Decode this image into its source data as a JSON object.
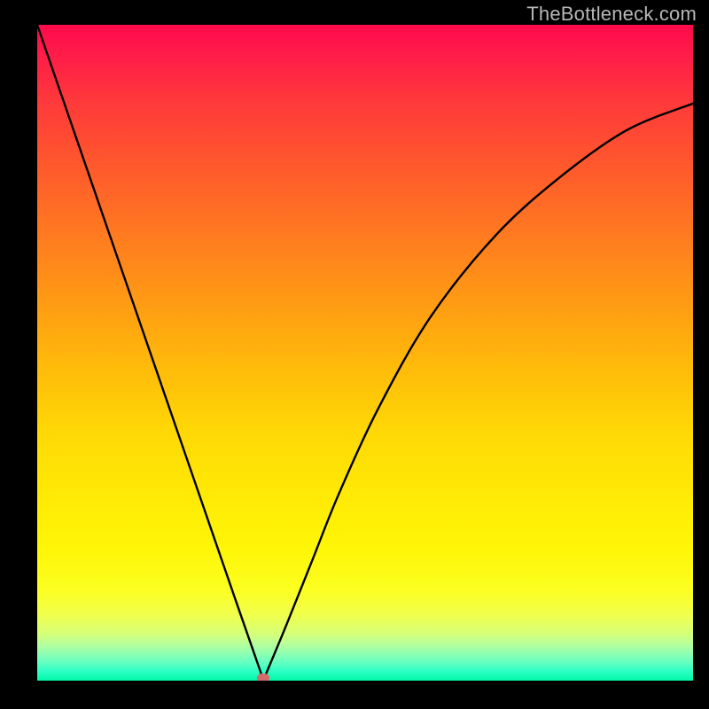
{
  "watermark": "TheBottleneck.com",
  "colors": {
    "background": "#000000",
    "curve": "#000000",
    "marker": "#d46a6a",
    "watermark": "#b7b7b7"
  },
  "chart_data": {
    "type": "line",
    "title": "",
    "xlabel": "",
    "ylabel": "",
    "xlim": [
      0,
      1
    ],
    "ylim": [
      0,
      1
    ],
    "grid": false,
    "legend": false,
    "annotations": [],
    "series": [
      {
        "name": "bottleneck-curve",
        "x": [
          0.0,
          0.05,
          0.1,
          0.15,
          0.2,
          0.25,
          0.3,
          0.34,
          0.345,
          0.35,
          0.38,
          0.42,
          0.46,
          0.52,
          0.6,
          0.7,
          0.8,
          0.9,
          1.0
        ],
        "y": [
          1.0,
          0.855,
          0.71,
          0.565,
          0.42,
          0.275,
          0.13,
          0.015,
          0.0,
          0.013,
          0.085,
          0.185,
          0.285,
          0.415,
          0.555,
          0.68,
          0.77,
          0.84,
          0.88
        ]
      }
    ],
    "marker": {
      "x": 0.345,
      "y": 0.0
    },
    "gradient_stops": [
      {
        "pos": 0.0,
        "color": "#ff0a4a"
      },
      {
        "pos": 0.5,
        "color": "#ffba0a"
      },
      {
        "pos": 0.85,
        "color": "#fcff20"
      },
      {
        "pos": 1.0,
        "color": "#00f8a6"
      }
    ]
  }
}
